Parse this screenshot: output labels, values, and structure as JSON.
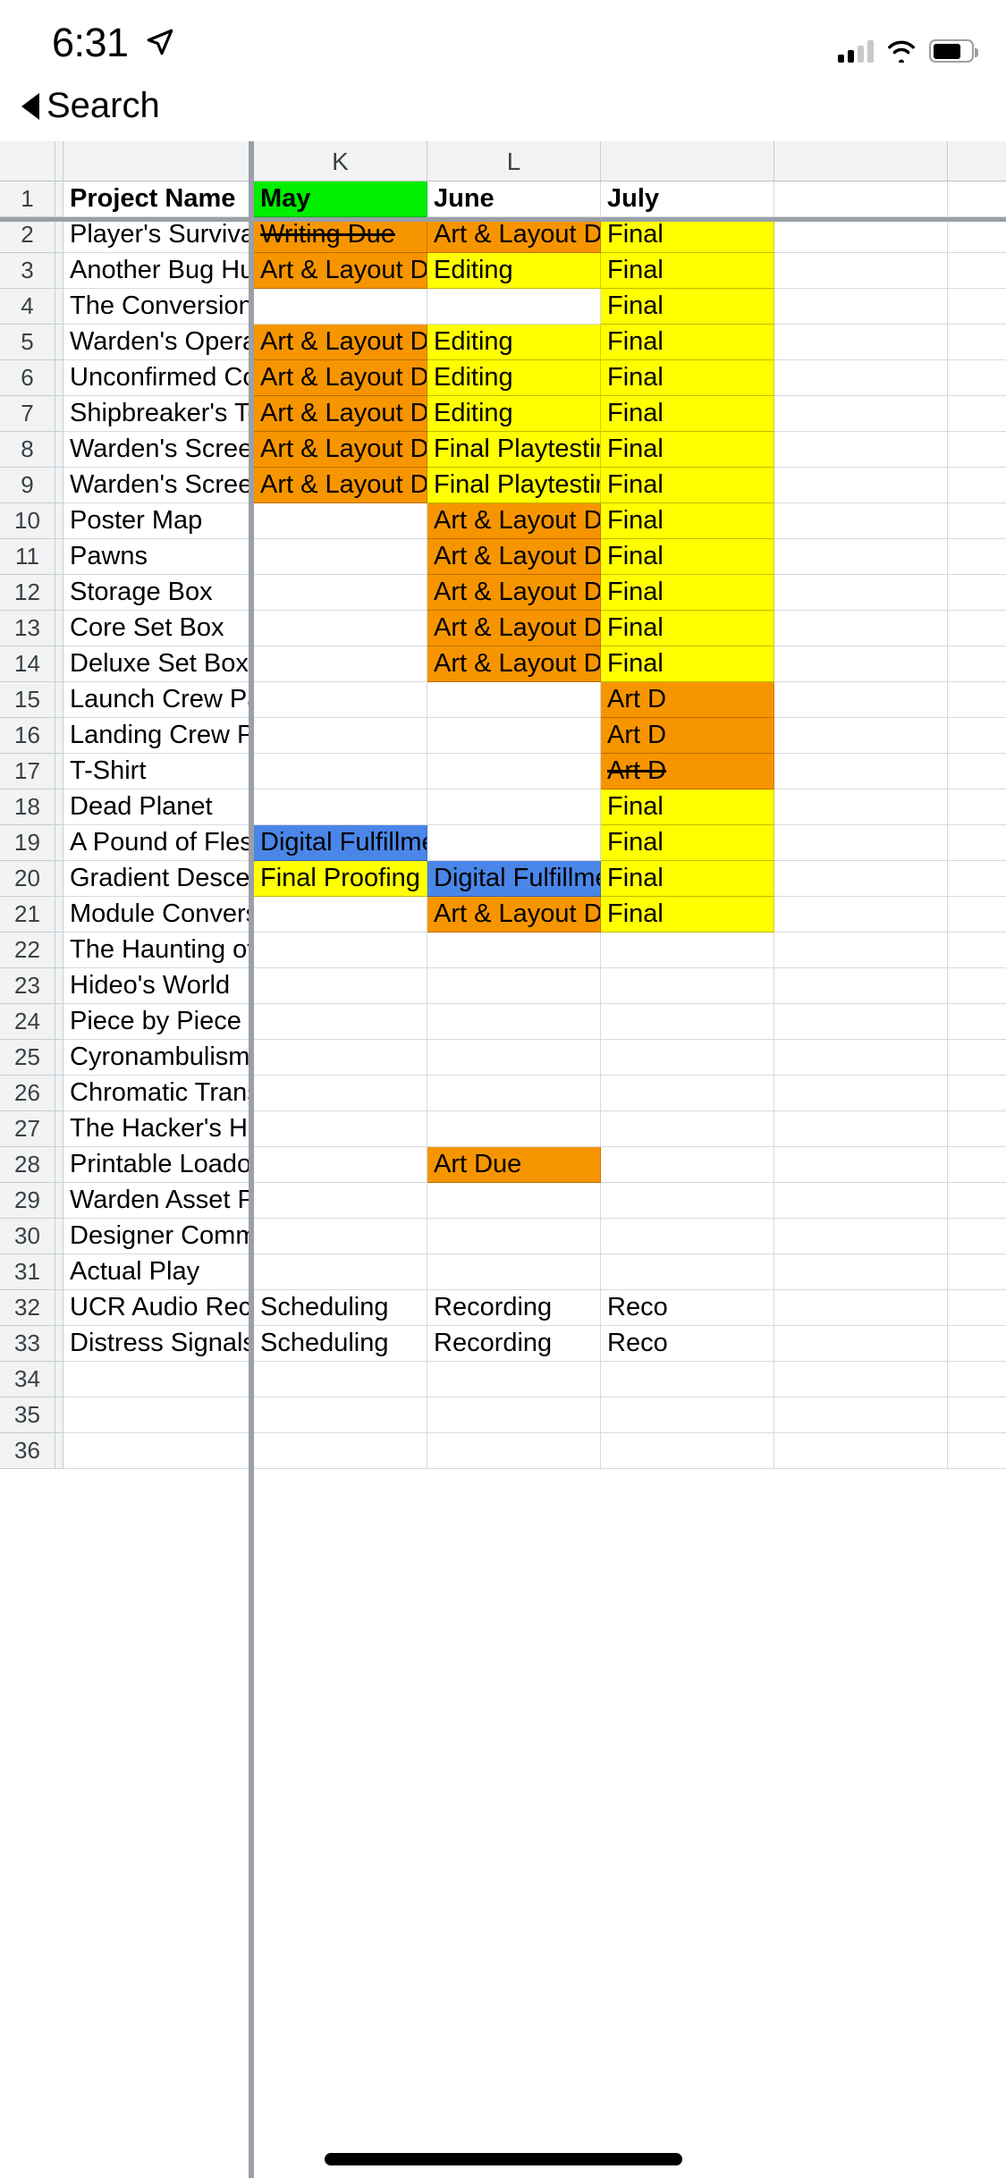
{
  "status_bar": {
    "time": "6:31",
    "location_icon": "location-arrow-icon",
    "cellular_icon": "cellular-bars-icon",
    "wifi_icon": "wifi-icon",
    "battery_icon": "battery-icon"
  },
  "back": {
    "label": "Search",
    "caret_icon": "back-caret-icon"
  },
  "spreadsheet": {
    "column_headers": [
      "",
      "",
      "",
      "K",
      "L",
      ""
    ],
    "colors": {
      "green": "#00EE00",
      "orange": "#F79500",
      "yellow": "#FFFF00",
      "blue": "#4A86E8",
      "white": "#FFFFFF",
      "header_grey": "#F1F3F4",
      "grid_line": "#D7DADD",
      "freeze_line": "#9AA0A6"
    },
    "rows": [
      {
        "num": "1",
        "name": "Project Name",
        "name_bold": true,
        "k": "May",
        "k_bg": "green",
        "k_bold": true,
        "l": "June",
        "l_bg": "white",
        "l_bold": true,
        "m": "July",
        "m_bg": "white",
        "m_bold": true,
        "n": "",
        "o": ""
      },
      {
        "num": "2",
        "name": "Player's Survival G",
        "k": "Writing Due",
        "k_bg": "orange",
        "k_strike": true,
        "l": "Art & Layout Due",
        "l_bg": "orange",
        "m": "Final",
        "m_bg": "yellow",
        "n": "",
        "o": ""
      },
      {
        "num": "3",
        "name": "Another Bug Hunt",
        "k": "Art & Layout Due",
        "k_bg": "orange",
        "l": "Editing",
        "l_bg": "yellow",
        "m": "Final",
        "m_bg": "yellow",
        "n": "",
        "o": ""
      },
      {
        "num": "4",
        "name": "The Conversion Ki",
        "k": "",
        "k_bg": "white",
        "l": "",
        "l_bg": "white",
        "m": "Final",
        "m_bg": "yellow",
        "n": "",
        "o": ""
      },
      {
        "num": "5",
        "name": "Warden's Operati",
        "k": "Art & Layout Due",
        "k_bg": "orange",
        "l": "Editing",
        "l_bg": "yellow",
        "m": "Final",
        "m_bg": "yellow",
        "n": "",
        "o": ""
      },
      {
        "num": "6",
        "name": "Unconfirmed Con",
        "k": "Art & Layout Due",
        "k_bg": "orange",
        "l": "Editing",
        "l_bg": "yellow",
        "m": "Final",
        "m_bg": "yellow",
        "n": "",
        "o": ""
      },
      {
        "num": "7",
        "name": "Shipbreaker's Too",
        "k": "Art & Layout Due",
        "k_bg": "orange",
        "l": "Editing",
        "l_bg": "yellow",
        "m": "Final",
        "m_bg": "yellow",
        "n": "",
        "o": ""
      },
      {
        "num": "8",
        "name": "Warden's Screen",
        "k": "Art & Layout Due",
        "k_bg": "orange",
        "l": "Final Playtesting",
        "l_bg": "yellow",
        "m": "Final",
        "m_bg": "yellow",
        "n": "",
        "o": ""
      },
      {
        "num": "9",
        "name": "Warden's Screen",
        "k": "Art & Layout Due",
        "k_bg": "orange",
        "l": "Final Playtesting",
        "l_bg": "yellow",
        "m": "Final",
        "m_bg": "yellow",
        "n": "",
        "o": ""
      },
      {
        "num": "10",
        "name": "Poster Map",
        "k": "",
        "k_bg": "white",
        "l": "Art & Layout Due",
        "l_bg": "orange",
        "m": "Final",
        "m_bg": "yellow",
        "n": "",
        "o": ""
      },
      {
        "num": "11",
        "name": "Pawns",
        "k": "",
        "k_bg": "white",
        "l": "Art & Layout Due",
        "l_bg": "orange",
        "m": "Final",
        "m_bg": "yellow",
        "n": "",
        "o": ""
      },
      {
        "num": "12",
        "name": "Storage Box",
        "k": "",
        "k_bg": "white",
        "l": "Art & Layout Due",
        "l_bg": "orange",
        "m": "Final",
        "m_bg": "yellow",
        "n": "",
        "o": ""
      },
      {
        "num": "13",
        "name": "Core Set Box",
        "k": "",
        "k_bg": "white",
        "l": "Art & Layout Due",
        "l_bg": "orange",
        "m": "Final",
        "m_bg": "yellow",
        "n": "",
        "o": ""
      },
      {
        "num": "14",
        "name": "Deluxe Set Box",
        "k": "",
        "k_bg": "white",
        "l": "Art & Layout Due",
        "l_bg": "orange",
        "m": "Final",
        "m_bg": "yellow",
        "n": "",
        "o": ""
      },
      {
        "num": "15",
        "name": "Launch Crew Patc",
        "k": "",
        "k_bg": "white",
        "l": "",
        "l_bg": "white",
        "m": "Art D",
        "m_bg": "orange",
        "n": "",
        "o": ""
      },
      {
        "num": "16",
        "name": "Landing Crew Pat",
        "k": "",
        "k_bg": "white",
        "l": "",
        "l_bg": "white",
        "m": "Art D",
        "m_bg": "orange",
        "n": "",
        "o": ""
      },
      {
        "num": "17",
        "name": "T-Shirt",
        "k": "",
        "k_bg": "white",
        "l": "",
        "l_bg": "white",
        "m": "Art D",
        "m_bg": "orange",
        "m_strike": true,
        "n": "",
        "o": ""
      },
      {
        "num": "18",
        "name": "Dead Planet",
        "k": "",
        "k_bg": "white",
        "l": "",
        "l_bg": "white",
        "m": "Final",
        "m_bg": "yellow",
        "n": "",
        "o": ""
      },
      {
        "num": "19",
        "name": "A Pound of Flesh",
        "k": "Digital Fulfillment",
        "k_bg": "blue",
        "l": "",
        "l_bg": "white",
        "m": "Final",
        "m_bg": "yellow",
        "n": "",
        "o": ""
      },
      {
        "num": "20",
        "name": "Gradient Descent",
        "k": "Final Proofing",
        "k_bg": "yellow",
        "l": "Digital Fulfillment",
        "l_bg": "blue",
        "m": "Final",
        "m_bg": "yellow",
        "n": "",
        "o": ""
      },
      {
        "num": "21",
        "name": "Module Conversio",
        "k": "",
        "k_bg": "white",
        "l": "Art & Layout Due",
        "l_bg": "orange",
        "m": "Final",
        "m_bg": "yellow",
        "n": "",
        "o": ""
      },
      {
        "num": "22",
        "name": "The Haunting of Y",
        "k": "",
        "k_bg": "white",
        "l": "",
        "l_bg": "white",
        "m": "",
        "m_bg": "white",
        "n": "",
        "o": ""
      },
      {
        "num": "23",
        "name": "Hideo's World",
        "k": "",
        "k_bg": "white",
        "l": "",
        "l_bg": "white",
        "m": "",
        "m_bg": "white",
        "n": "",
        "o": ""
      },
      {
        "num": "24",
        "name": "Piece by Piece",
        "k": "",
        "k_bg": "white",
        "l": "",
        "l_bg": "white",
        "m": "",
        "m_bg": "white",
        "n": "",
        "o": ""
      },
      {
        "num": "25",
        "name": "Cyronambulism",
        "k": "",
        "k_bg": "white",
        "l": "",
        "l_bg": "white",
        "m": "",
        "m_bg": "white",
        "n": "",
        "o": ""
      },
      {
        "num": "26",
        "name": "Chromatic Transfe",
        "k": "",
        "k_bg": "white",
        "l": "",
        "l_bg": "white",
        "m": "",
        "m_bg": "white",
        "n": "",
        "o": ""
      },
      {
        "num": "27",
        "name": "The Hacker's Han",
        "k": "",
        "k_bg": "white",
        "l": "",
        "l_bg": "white",
        "m": "",
        "m_bg": "white",
        "n": "",
        "o": ""
      },
      {
        "num": "28",
        "name": "Printable Loadout",
        "k": "",
        "k_bg": "white",
        "l": "Art Due",
        "l_bg": "orange",
        "m": "",
        "m_bg": "white",
        "n": "",
        "o": ""
      },
      {
        "num": "29",
        "name": "Warden Asset Pac",
        "k": "",
        "k_bg": "white",
        "l": "",
        "l_bg": "white",
        "m": "",
        "m_bg": "white",
        "n": "",
        "o": ""
      },
      {
        "num": "30",
        "name": "Designer Commer",
        "k": "",
        "k_bg": "white",
        "l": "",
        "l_bg": "white",
        "m": "",
        "m_bg": "white",
        "n": "",
        "o": ""
      },
      {
        "num": "31",
        "name": "Actual Play",
        "k": "",
        "k_bg": "white",
        "l": "",
        "l_bg": "white",
        "m": "",
        "m_bg": "white",
        "n": "",
        "o": ""
      },
      {
        "num": "32",
        "name": "UCR Audio Record",
        "k": "Scheduling",
        "k_bg": "white",
        "l": "Recording",
        "l_bg": "white",
        "m": "Reco",
        "m_bg": "white",
        "n": "",
        "o": ""
      },
      {
        "num": "33",
        "name": "Distress Signals",
        "k": "Scheduling",
        "k_bg": "white",
        "l": "Recording",
        "l_bg": "white",
        "m": "Reco",
        "m_bg": "white",
        "n": "",
        "o": ""
      },
      {
        "num": "34",
        "name": "",
        "k": "",
        "k_bg": "white",
        "l": "",
        "l_bg": "white",
        "m": "",
        "m_bg": "white",
        "n": "",
        "o": ""
      },
      {
        "num": "35",
        "name": "",
        "k": "",
        "k_bg": "white",
        "l": "",
        "l_bg": "white",
        "m": "",
        "m_bg": "white",
        "n": "",
        "o": ""
      },
      {
        "num": "36",
        "name": "",
        "k": "",
        "k_bg": "white",
        "l": "",
        "l_bg": "white",
        "m": "",
        "m_bg": "white",
        "n": "",
        "o": ""
      }
    ]
  },
  "home_indicator": "home-indicator"
}
